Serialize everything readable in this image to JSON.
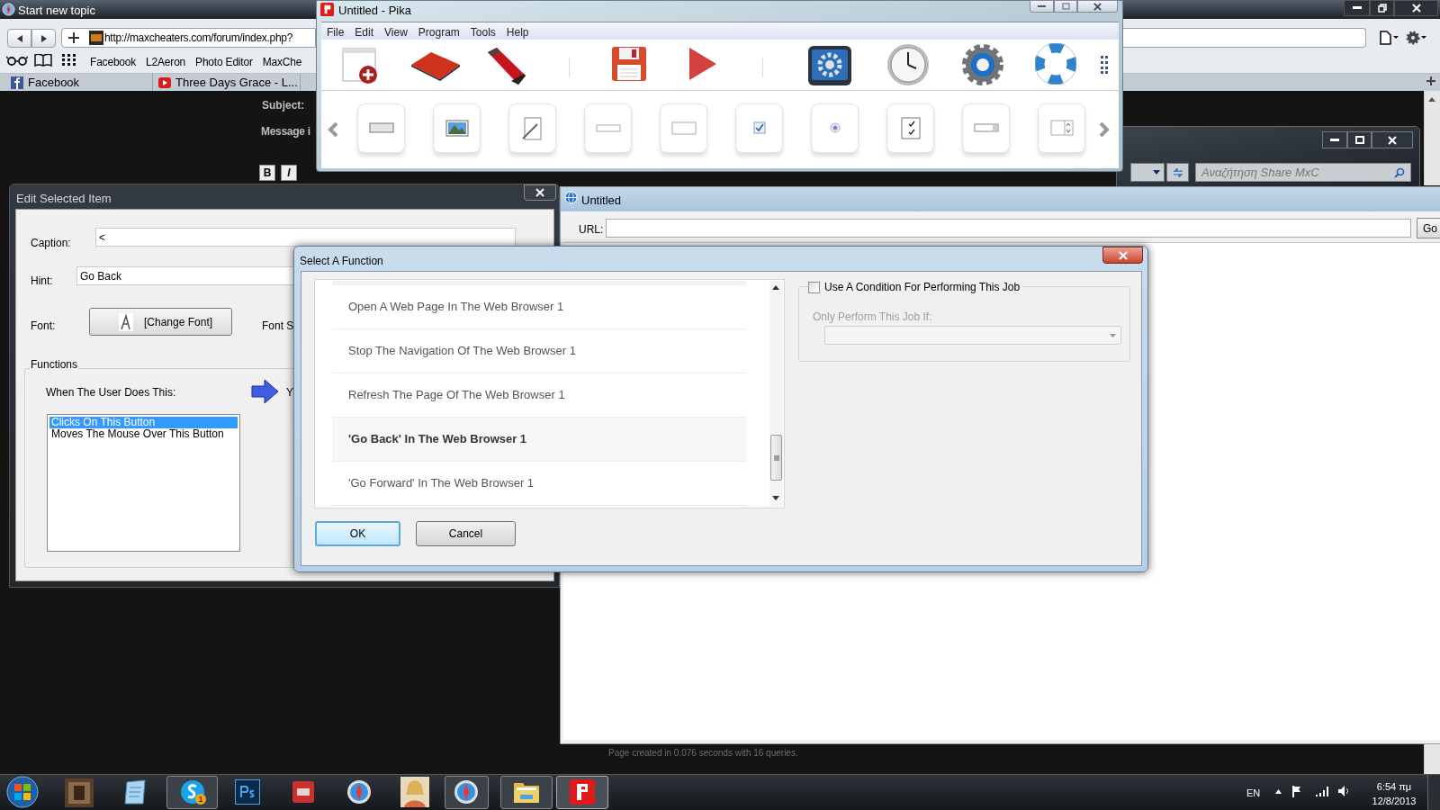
{
  "browser": {
    "title": "Start new topic",
    "url": "http://maxcheaters.com/forum/index.php?",
    "bookmarks": [
      "Facebook",
      "L2Aeron",
      "Photo Editor",
      "MaxChe"
    ],
    "tabs": [
      {
        "label": "Facebook",
        "selected": false
      },
      {
        "label": "Three Days Grace - L...",
        "selected": false
      }
    ],
    "form_labels": [
      "Subject:",
      "Message i"
    ],
    "format_buttons": [
      "B",
      "I"
    ],
    "footer": "Page created in 0.076 seconds with 16 queries."
  },
  "pika": {
    "title": "Untitled - Pika",
    "menu": [
      "File",
      "Edit",
      "View",
      "Program",
      "Tools",
      "Help"
    ]
  },
  "explorer": {
    "search": {
      "placeholder": "Αναζήτηση Share MxC"
    }
  },
  "web_window": {
    "title": "Untitled",
    "url_label": "URL:",
    "go_button": "Go"
  },
  "edit_item": {
    "title": "Edit Selected Item",
    "caption": {
      "label": "Caption:",
      "value": "<"
    },
    "hint": {
      "label": "Hint:",
      "value": "Go Back"
    },
    "font": {
      "label": "Font:",
      "button": "[Change Font]"
    },
    "font_size_label": "Font S",
    "functions": {
      "title": "Functions",
      "prompt": "When The User Does This:",
      "next_label": "Y",
      "events": [
        {
          "label": "Clicks On This Button",
          "selected": true
        },
        {
          "label": "Moves The Mouse Over This Button",
          "selected": false
        }
      ]
    }
  },
  "dialog": {
    "title": "Select A Function",
    "functions": [
      {
        "label": "Open A Web Page In The Web Browser 1",
        "selected": false
      },
      {
        "label": "Stop The Navigation Of The Web Browser 1",
        "selected": false
      },
      {
        "label": "Refresh The Page Of The Web Browser 1",
        "selected": false
      },
      {
        "label": "'Go Back' In The Web Browser 1",
        "selected": true
      },
      {
        "label": "'Go Forward' In The Web Browser 1",
        "selected": false
      }
    ],
    "condition": {
      "label": "Use A Condition For Performing This Job",
      "checked": false
    },
    "condition_field": {
      "label": "Only Perform This Job If:",
      "disabled": true
    },
    "buttons": [
      "OK",
      "Cancel"
    ]
  },
  "taskbar": {
    "badge": "1",
    "language": "EN",
    "time": "6:54 πμ",
    "date": "12/8/2013"
  }
}
